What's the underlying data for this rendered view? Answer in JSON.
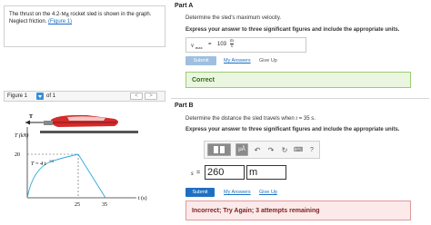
{
  "problem": {
    "text_before": "The thrust on the 4.2-",
    "unit_mg": "Mg",
    "text_after": " rocket sled is shown in the graph. Neglect friction.",
    "figure_link": "(Figure 1)"
  },
  "figure_nav": {
    "label": "Figure 1",
    "of_text": "of 1",
    "prev": "<",
    "next": ">"
  },
  "graph": {
    "y_axis_label": "T (kN)",
    "x_axis_label": "t (s)",
    "y_tick": "20",
    "x_ticks": [
      "25",
      "35"
    ],
    "curve_label": "T = 4 t",
    "curve_exp": "1/2",
    "rocket_label": "T"
  },
  "part_a": {
    "title": "Part A",
    "question": "Determine the sled's maximum velocity.",
    "instruction": "Express your answer to three significant figures and include the appropriate units.",
    "answer_var": "v",
    "answer_sub": "max",
    "equals": "=",
    "answer_value": "103",
    "answer_unit_num": "m",
    "answer_unit_den": "s",
    "submit": "Submit",
    "my_answers": "My Answers",
    "give_up": "Give Up",
    "result": "Correct"
  },
  "part_b": {
    "title": "Part B",
    "question_prefix": "Determine the distance the sled travels when ",
    "question_var": "t",
    "question_suffix": " = 35 s.",
    "instruction": "Express your answer to three significant figures and include the appropriate units.",
    "toolbar_mu": "μÅ",
    "toolbar_help": "?",
    "answer_var": "s",
    "equals": "=",
    "answer_value": "260",
    "answer_unit": "m",
    "submit": "Submit",
    "my_answers": "My Answers",
    "give_up": "Give Up",
    "result": "Incorrect; Try Again; 3 attempts remaining"
  },
  "colors": {
    "link": "#1a6fc2",
    "submit_a": "#9fbfe0",
    "submit_b": "#1f6fc1",
    "correct_bg": "#eaf6df",
    "incorrect_bg": "#fce9e9",
    "curve": "#2aa7d8"
  }
}
